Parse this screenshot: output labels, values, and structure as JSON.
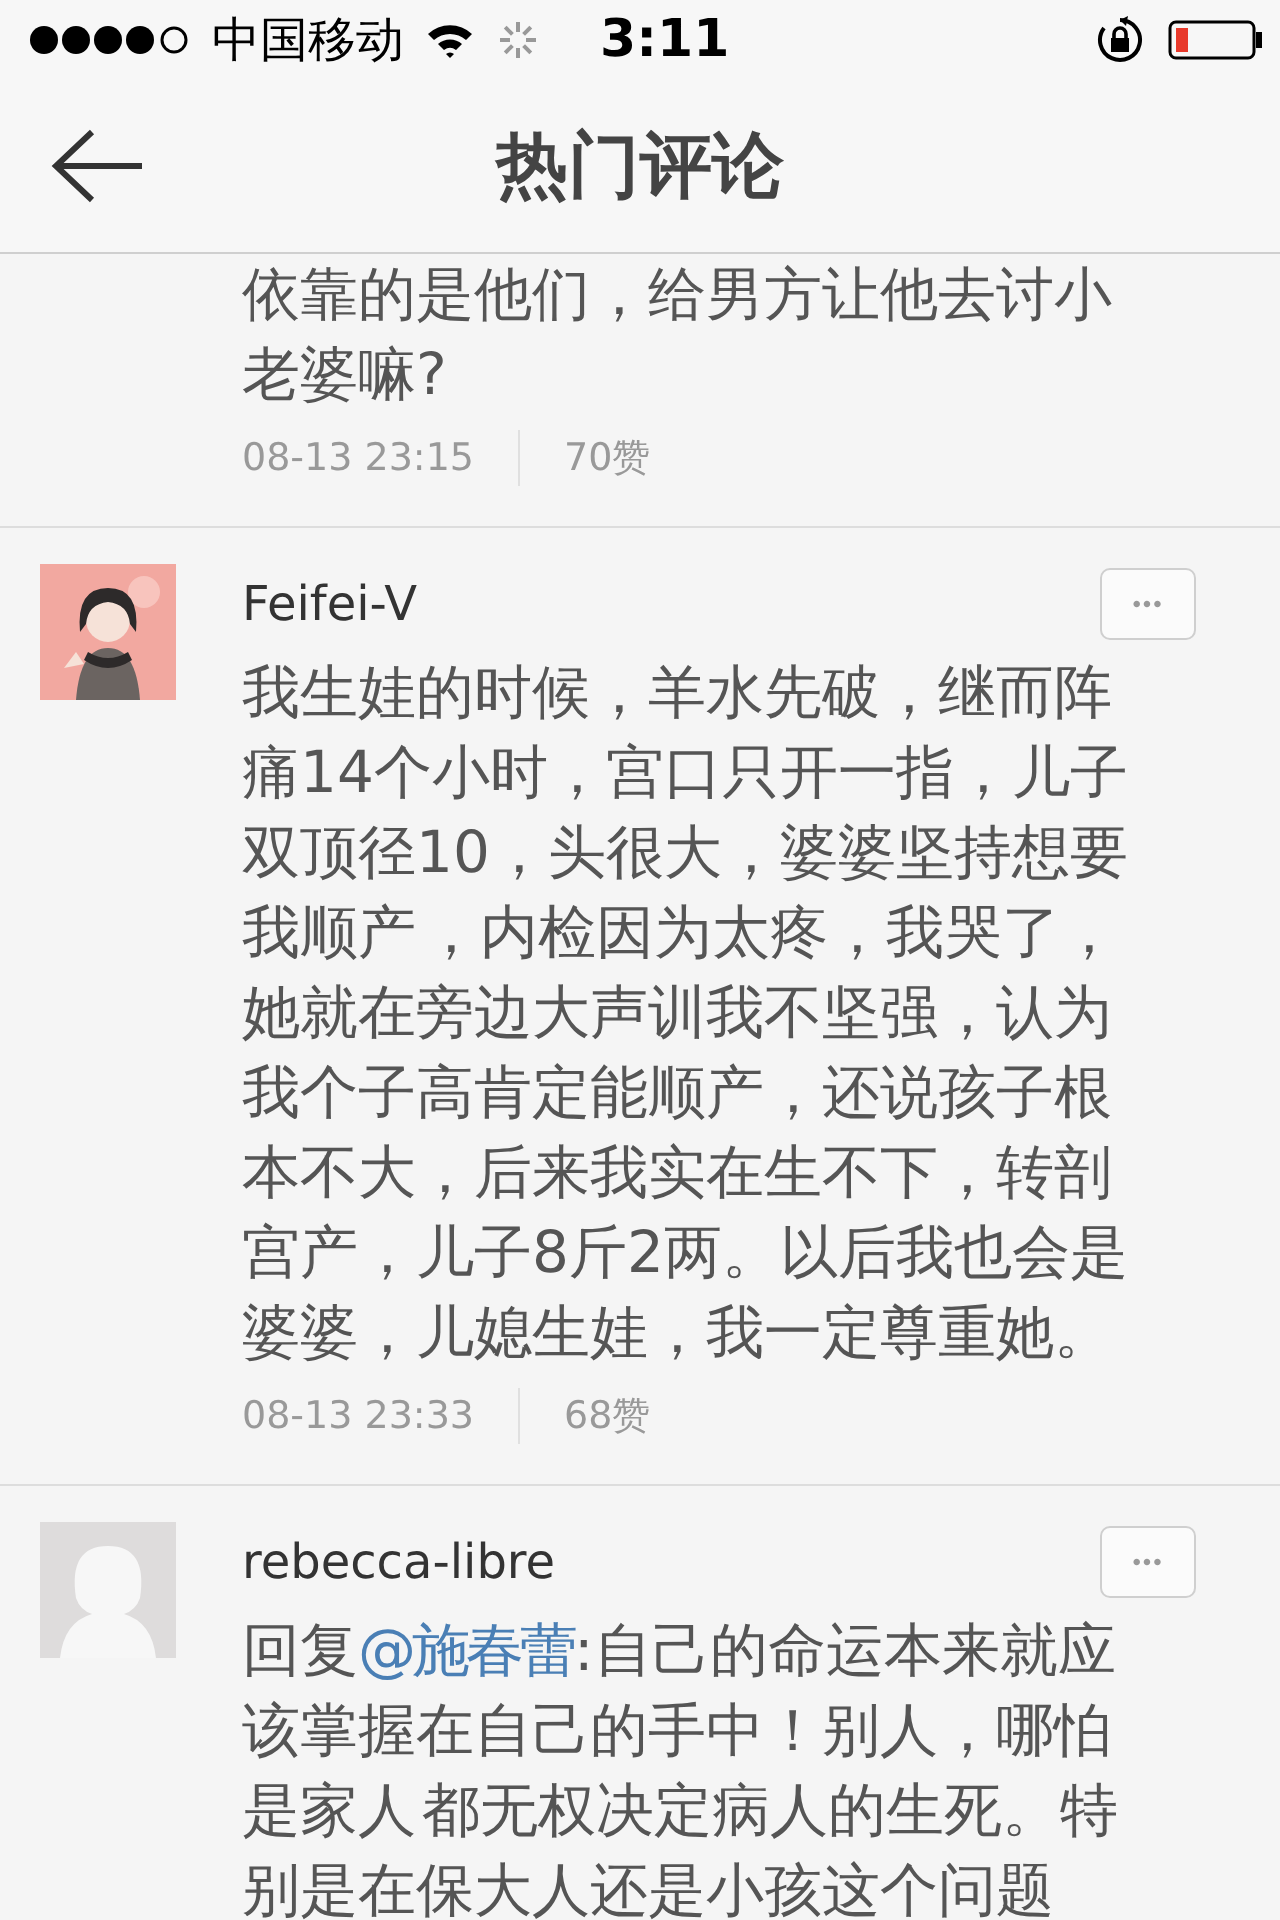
{
  "status_bar": {
    "carrier": "中国移动",
    "time": "3:11"
  },
  "nav": {
    "title": "热门评论"
  },
  "comments": [
    {
      "text": "依靠的是他们，给男方让他去讨小老婆嘛?",
      "date": "08-13 23:15",
      "likes": "70赞"
    },
    {
      "author": "Feifei-V",
      "more": "•••",
      "text": "我生娃的时候，羊水先破，继而阵痛14个小时，宫口只开一指，儿子双顶径10，头很大，婆婆坚持想要我顺产 ，内检因为太疼，我哭了，她就在旁边大声训我不坚强，认为我个子高肯定能顺产，还说孩子根本不大，后来我实在生不下，转剖宫产，儿子8斤2两。以后我也会是婆婆，儿媳生娃，我一定尊重她。",
      "date": "08-13 23:33",
      "likes": "68赞"
    },
    {
      "author": "rebecca-libre",
      "avatar": {
        "kind": "silhouette"
      },
      "more": "•••",
      "reply_prefix": "回复",
      "mention": "@施春蕾",
      "text": ":自己的命运本来就应该掌握在自己的手中！别人，哪怕是家人 都无权决定病人的生死。特别是在保大人还是小孩这个问题"
    }
  ]
}
